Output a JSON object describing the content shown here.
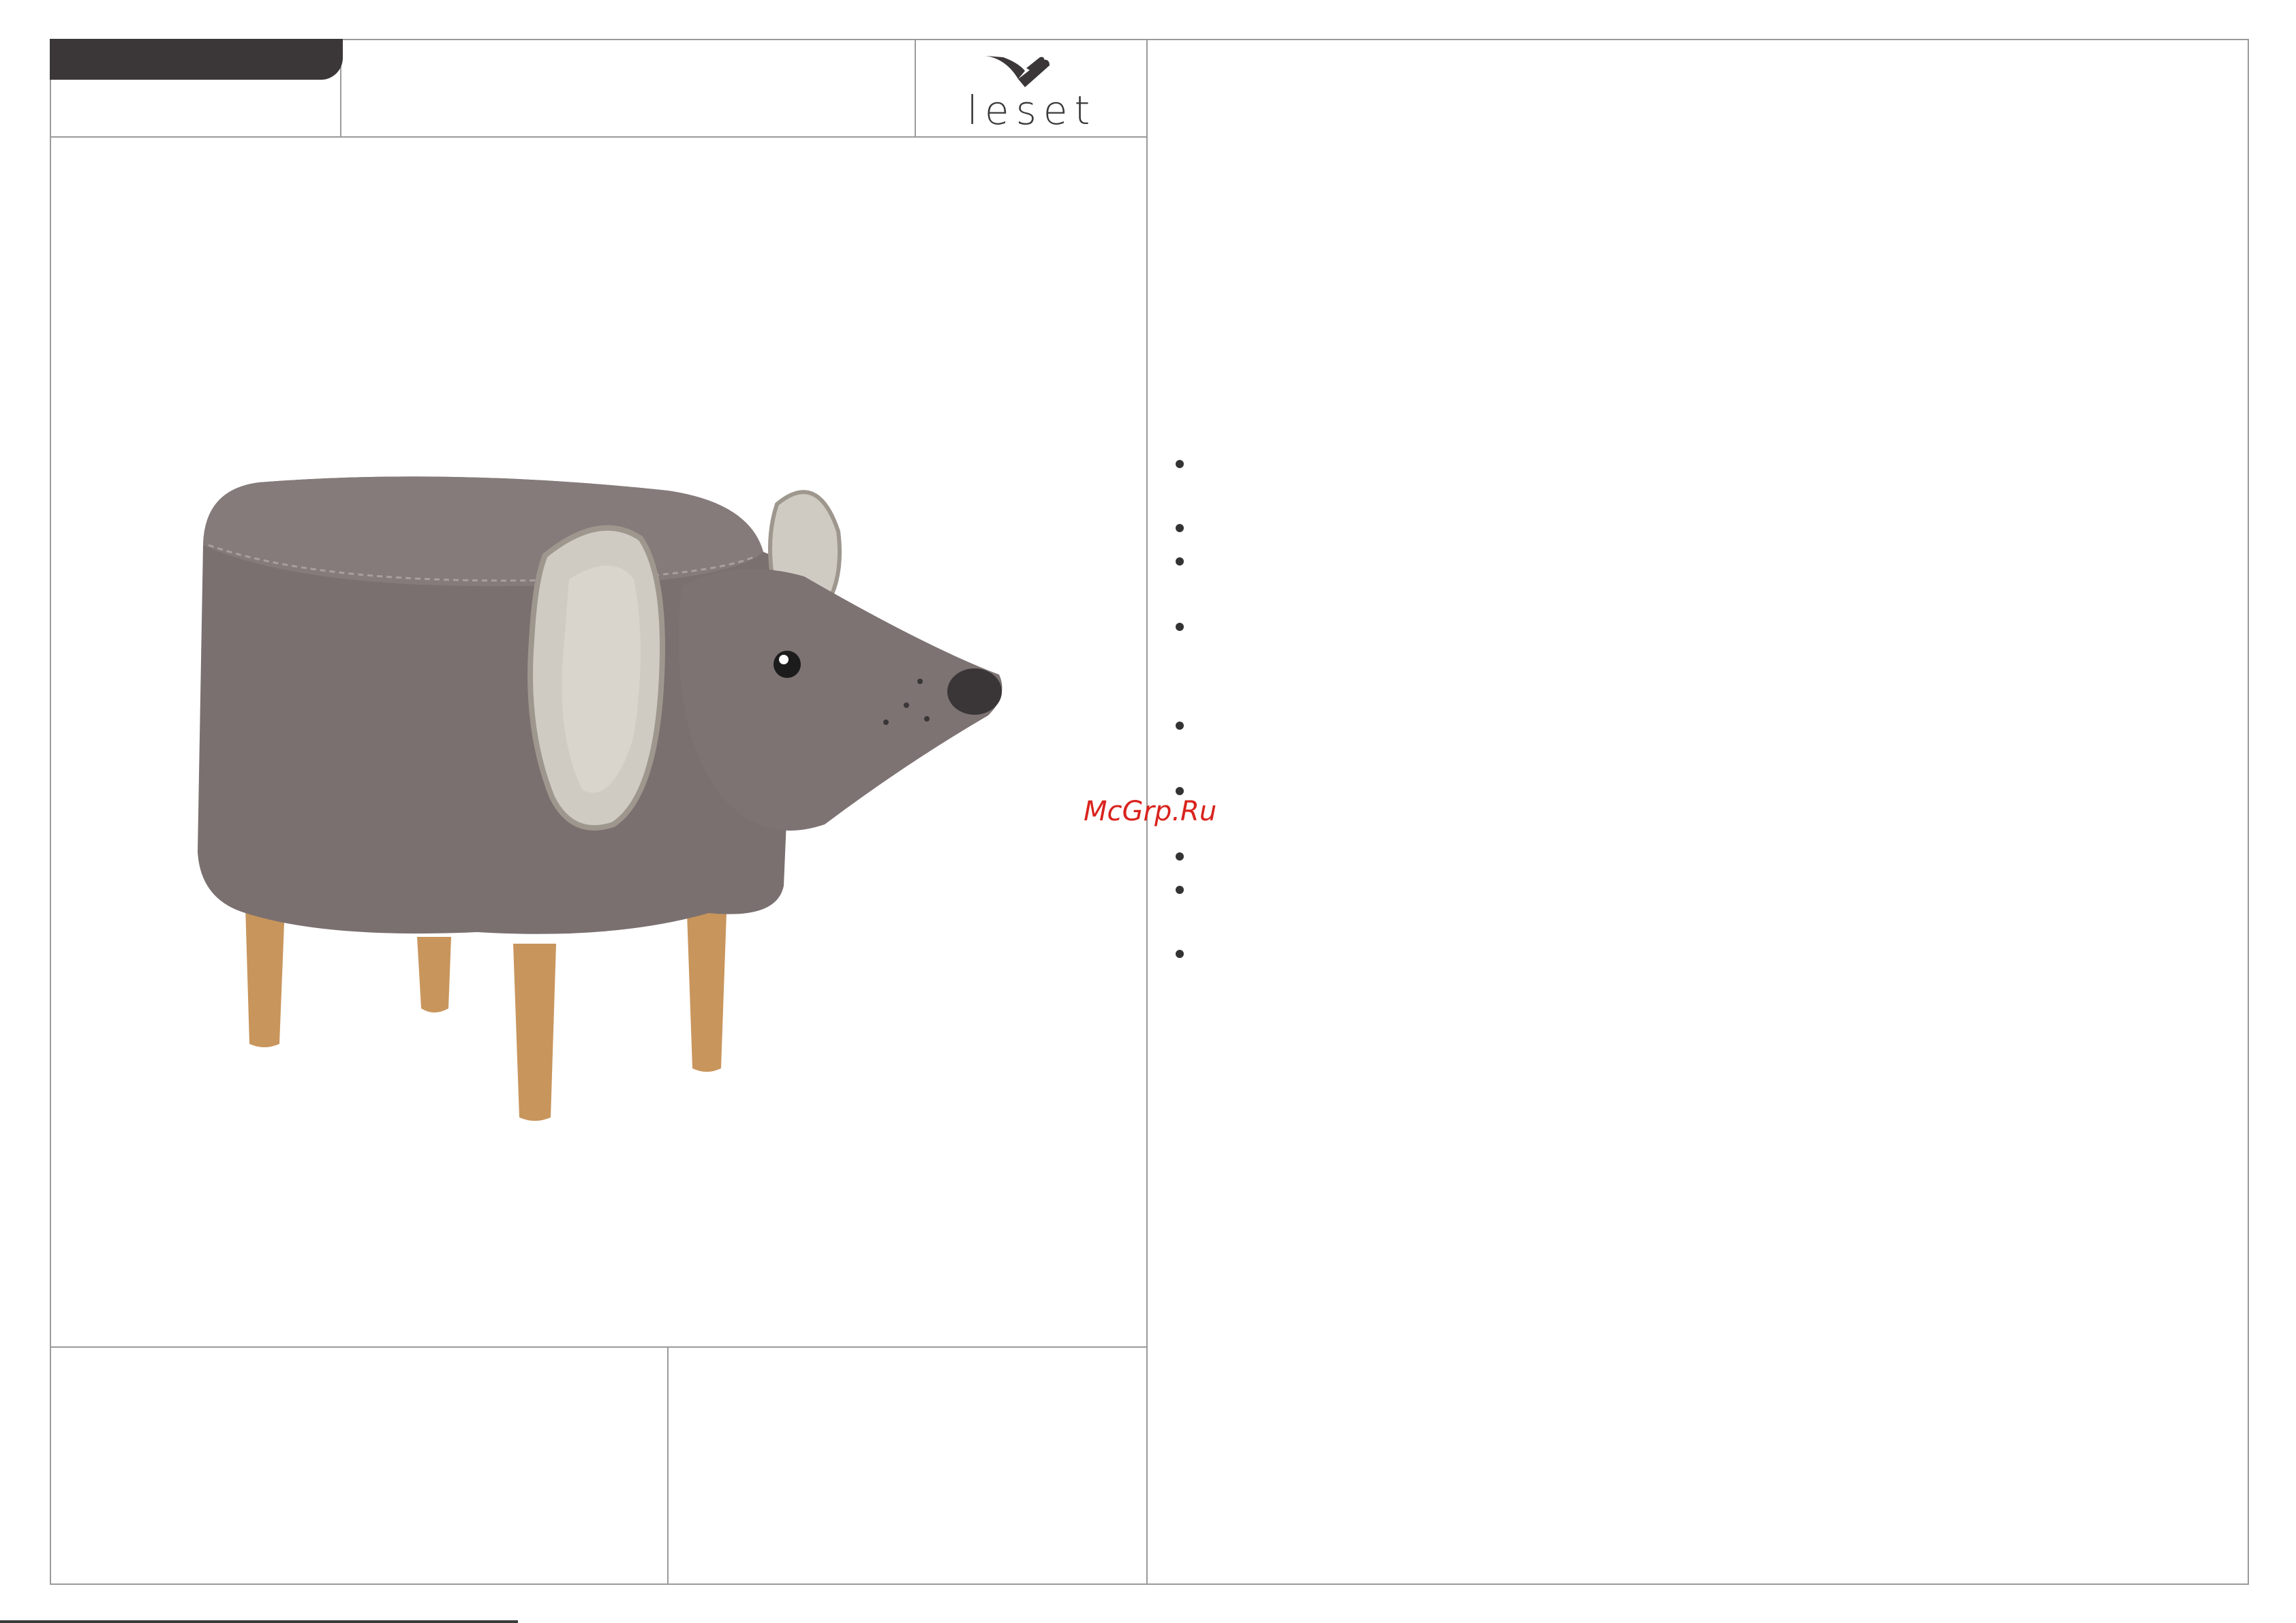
{
  "brand": {
    "logo_text": "leset",
    "logo_icon": "leset-v-mark-icon"
  },
  "watermark": {
    "text": "McGrp.Ru",
    "color": "#d9231d"
  },
  "product_image": {
    "subject": "mouse-shaped-pouf",
    "body_color": "#7a706f",
    "ear_color": "#cfcbc3",
    "leg_color": "#c8955c"
  },
  "specs": {
    "bullet_count": 9
  },
  "colors": {
    "frame": "#9a9a9a",
    "tab": "#3b3637"
  }
}
